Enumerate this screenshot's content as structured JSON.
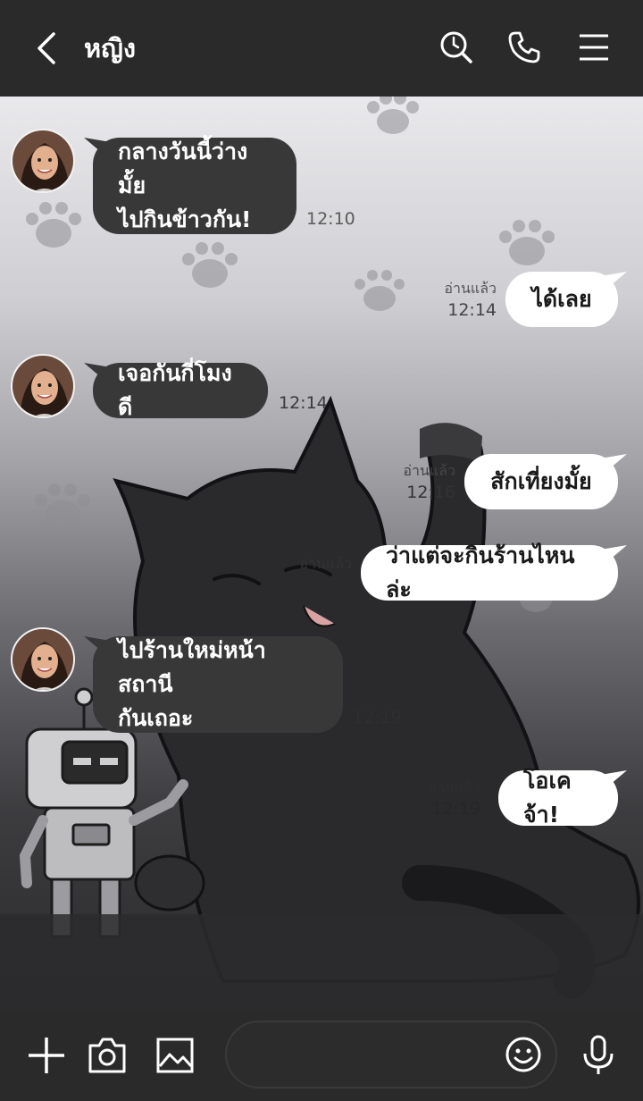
{
  "header": {
    "title": "หญิง",
    "back_icon": "chevron-left-icon",
    "icons": [
      "search-history-icon",
      "phone-icon",
      "menu-icon"
    ]
  },
  "messages": [
    {
      "side": "left",
      "lines": [
        "กลางวันนี้ว่างมั้ย",
        "ไปกินข้าวกัน!"
      ],
      "time": "12:10"
    },
    {
      "side": "right",
      "text": "ได้เลย",
      "read": "อ่านแล้ว",
      "time": "12:14"
    },
    {
      "side": "left",
      "lines": [
        "เจอกันกี่โมงดี"
      ],
      "time": "12:14"
    },
    {
      "side": "right",
      "text": "สักเที่ยงมั้ย",
      "read": "อ่านแล้ว",
      "time": "12:16"
    },
    {
      "side": "right",
      "text": "ว่าแต่จะกินร้านไหนล่ะ",
      "read": "อ่านแล้ว",
      "time": "12:17"
    },
    {
      "side": "left",
      "lines": [
        "ไปร้านใหม่หน้าสถานี",
        "กันเถอะ"
      ],
      "time": "12:19"
    },
    {
      "side": "right",
      "text": "โอเคจ้า!",
      "read": "อ่านแล้ว",
      "time": "12:19"
    }
  ],
  "bottom": {
    "input_placeholder": "",
    "icons": [
      "plus-icon",
      "camera-icon",
      "image-icon",
      "emoji-icon",
      "microphone-icon"
    ]
  },
  "colors": {
    "header_bg": "#2a2a2a",
    "bubble_left": "#383838",
    "bubble_right": "#ffffff"
  }
}
